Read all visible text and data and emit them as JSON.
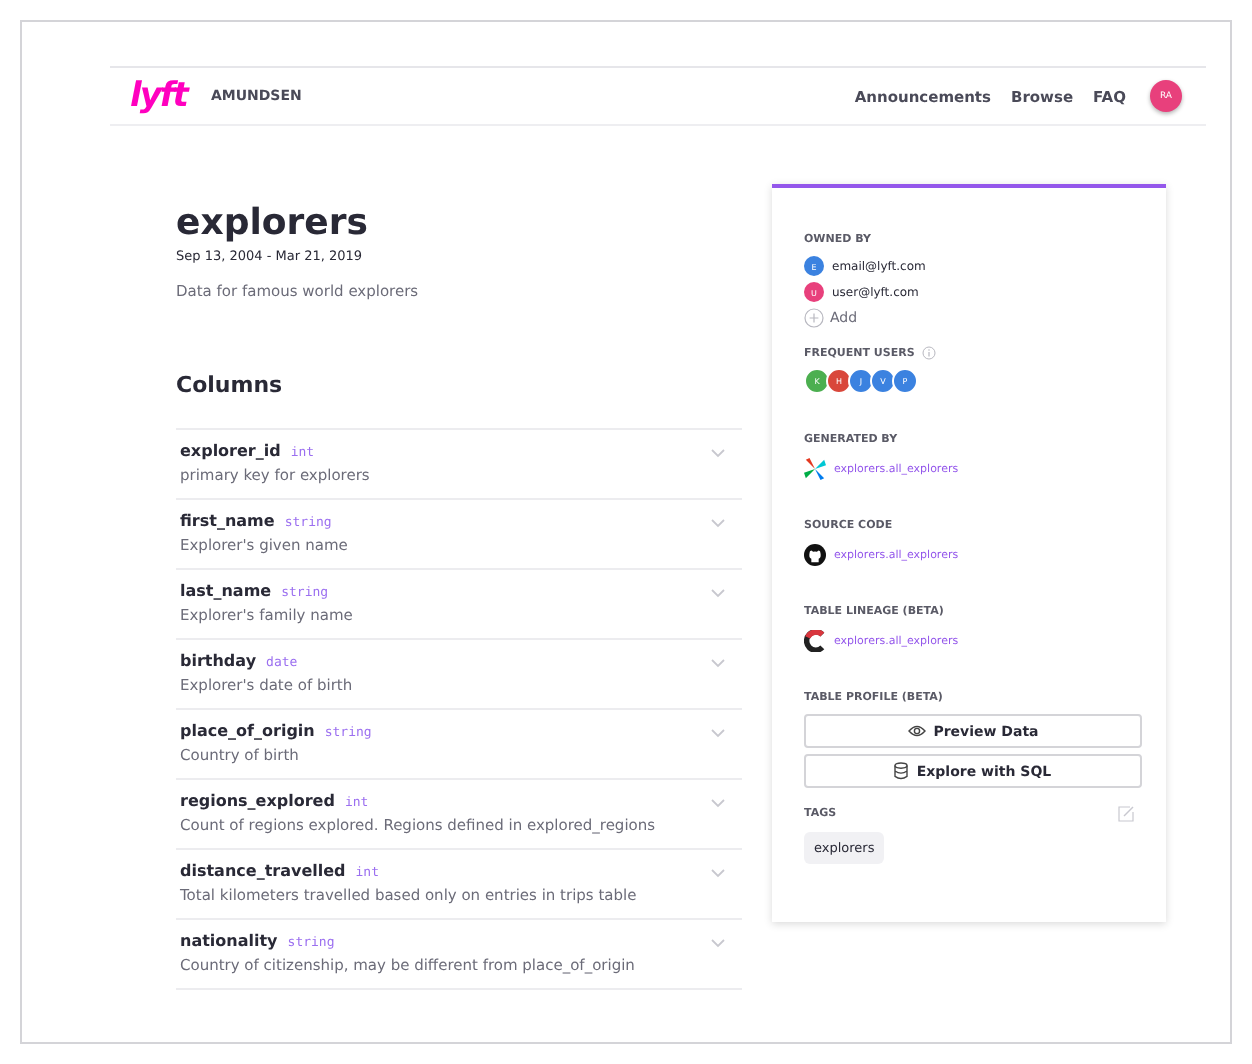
{
  "header": {
    "logo": "lyft",
    "brand": "AMUNDSEN",
    "nav": [
      "Announcements",
      "Browse",
      "FAQ"
    ],
    "avatar": {
      "initials": "RA",
      "color": "#e8407c"
    }
  },
  "table": {
    "name": "explorers",
    "date_range": "Sep 13, 2004 - Mar 21, 2019",
    "description": "Data for famous world explorers"
  },
  "columns_title": "Columns",
  "columns": [
    {
      "name": "explorer_id",
      "type": "int",
      "description": "primary key for explorers",
      "expanded": false
    },
    {
      "name": "first_name",
      "type": "string",
      "description": "Explorer's given name",
      "expanded": false
    },
    {
      "name": "last_name",
      "type": "string",
      "description": "Explorer's family name",
      "expanded": false
    },
    {
      "name": "birthday",
      "type": "date",
      "description": "Explorer's date of birth",
      "expanded": false
    },
    {
      "name": "place_of_origin",
      "type": "string",
      "description": "Country of birth",
      "expanded": false
    },
    {
      "name": "regions_explored",
      "type": "int",
      "description": "Count of regions explored. Regions defined in explored_regions",
      "expanded": false
    },
    {
      "name": "distance_travelled",
      "type": "int",
      "description": "Total kilometers travelled based only on entries in trips table",
      "expanded": false
    },
    {
      "name": "nationality",
      "type": "string",
      "description": "Country of citizenship, may be different from place_of_origin",
      "expanded": false
    }
  ],
  "sidebar": {
    "owned_by": {
      "label": "OWNED BY",
      "owners": [
        {
          "initial": "E",
          "email": "email@lyft.com",
          "color": "#3b82e0"
        },
        {
          "initial": "U",
          "email": "user@lyft.com",
          "color": "#e8407c"
        }
      ],
      "add": "Add"
    },
    "frequent_users": {
      "label": "FREQUENT USERS",
      "users": [
        {
          "initial": "K",
          "color": "#4caf50"
        },
        {
          "initial": "H",
          "color": "#d9473b"
        },
        {
          "initial": "J",
          "color": "#3b82e0"
        },
        {
          "initial": "V",
          "color": "#3b82e0"
        },
        {
          "initial": "P",
          "color": "#3b82e0"
        }
      ]
    },
    "sections": [
      {
        "label": "GENERATED BY",
        "kind": "airflow",
        "link": "explorers.all_explorers"
      },
      {
        "label": "SOURCE CODE",
        "kind": "github",
        "link": "explorers.all_explorers"
      },
      {
        "label": "TABLE LINEAGE (BETA)",
        "kind": "lineage",
        "link": "explorers.all_explorers"
      }
    ],
    "table_profile": {
      "label": "TABLE PROFILE (BETA)",
      "buttons": [
        {
          "label": "Preview Data",
          "kind": "eye"
        },
        {
          "label": "Explore with SQL",
          "kind": "database"
        }
      ]
    },
    "tags": {
      "label": "TAGS",
      "items": [
        "explorers"
      ]
    }
  }
}
